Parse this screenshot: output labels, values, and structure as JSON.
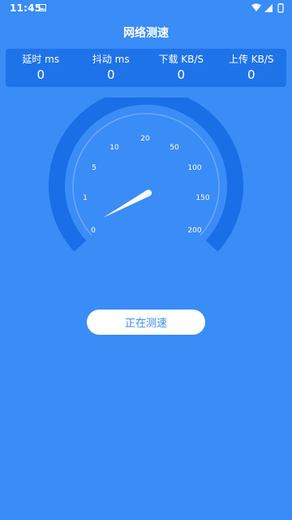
{
  "status_bar": {
    "time": "11:45",
    "left_icon": "image-notification-icon",
    "right_icons": [
      "wifi-icon",
      "cellular-signal-icon",
      "battery-icon"
    ]
  },
  "header": {
    "title": "网络测速"
  },
  "stats": [
    {
      "label": "延时 ms",
      "value": "0"
    },
    {
      "label": "抖动 ms",
      "value": "0"
    },
    {
      "label": "下载 KB/S",
      "value": "0"
    },
    {
      "label": "上传 KB/S",
      "value": "0"
    }
  ],
  "gauge": {
    "tick_labels": [
      "0",
      "1",
      "5",
      "10",
      "20",
      "50",
      "100",
      "150",
      "200"
    ],
    "needle_value": 0
  },
  "action": {
    "label": "正在测速"
  },
  "colors": {
    "background": "#3a8cf7",
    "panel": "#1e73e8",
    "gauge_ring": "#1a6ee6",
    "gauge_inner_line": "#6aa8fa",
    "button_text": "#3a8cf7"
  }
}
